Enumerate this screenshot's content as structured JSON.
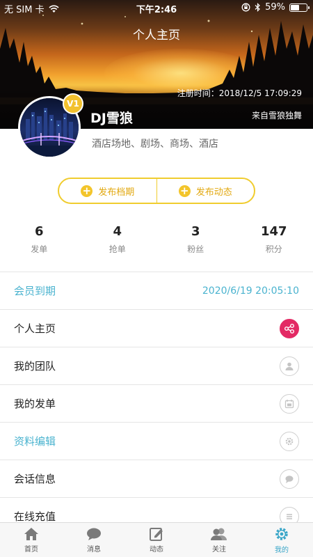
{
  "status_bar": {
    "carrier": "无 SIM 卡",
    "time": "下午2:46",
    "battery": "59%",
    "battery_level": 0.59
  },
  "header": {
    "title": "个人主页",
    "register_time": "注册时间：2018/12/5 17:09:29",
    "username": "DJ雪狼",
    "from_text": "来自雪狼独舞",
    "vip_badge": "V1",
    "tags": "酒店场地、剧场、商场、酒店"
  },
  "actions": {
    "publish_schedule": "发布档期",
    "publish_dynamic": "发布动态"
  },
  "stats": [
    {
      "value": "6",
      "label": "发单"
    },
    {
      "value": "4",
      "label": "抢单"
    },
    {
      "value": "3",
      "label": "粉丝"
    },
    {
      "value": "147",
      "label": "积分"
    }
  ],
  "menu": {
    "membership_label": "会员到期",
    "membership_value": "2020/6/19 20:05:10",
    "items": [
      {
        "label": "个人主页",
        "icon": "share-icon"
      },
      {
        "label": "我的团队",
        "icon": "user-icon"
      },
      {
        "label": "我的发单",
        "icon": "calendar-icon"
      },
      {
        "label": "资料编辑",
        "icon": "gear-icon"
      },
      {
        "label": "会话信息",
        "icon": "chat-icon"
      },
      {
        "label": "在线充值",
        "icon": "list-icon"
      }
    ]
  },
  "tabbar": [
    {
      "label": "首页",
      "icon": "home-icon"
    },
    {
      "label": "消息",
      "icon": "message-icon"
    },
    {
      "label": "动态",
      "icon": "edit-icon"
    },
    {
      "label": "关注",
      "icon": "follow-icon"
    },
    {
      "label": "我的",
      "icon": "gear-icon"
    }
  ],
  "colors": {
    "accent_yellow": "#f0cc2e",
    "accent_blue": "#4ab3cf",
    "share_pink": "#e32a64"
  }
}
